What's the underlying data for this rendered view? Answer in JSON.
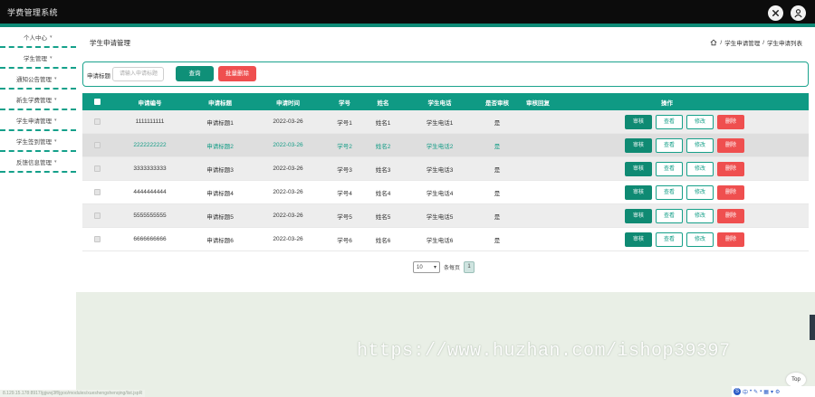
{
  "app": {
    "title": "学费管理系统"
  },
  "sidebar": {
    "items": [
      {
        "label": "个人中心"
      },
      {
        "label": "学生管理"
      },
      {
        "label": "通知公告管理"
      },
      {
        "label": "新生学费管理"
      },
      {
        "label": "学生申请管理"
      },
      {
        "label": "学生签到管理"
      },
      {
        "label": "反馈信息管理"
      }
    ]
  },
  "page": {
    "title": "学生申请管理",
    "breadcrumb": {
      "level1": "学生申请管理",
      "level2": "学生申请列表"
    }
  },
  "search": {
    "label": "申请标题",
    "placeholder": "请输入申请标题",
    "query_button": "查询",
    "batch_delete_button": "批量删除"
  },
  "table": {
    "headers": [
      "申请编号",
      "申请标题",
      "申请时间",
      "学号",
      "姓名",
      "学生电话",
      "是否审核",
      "审核回复",
      "操作"
    ],
    "rows": [
      {
        "id": "1111111111",
        "title": "申请标题1",
        "date": "2022-03-26",
        "student_no": "学号1",
        "name": "姓名1",
        "phone": "学生电话1",
        "audited": "是",
        "reply": ""
      },
      {
        "id": "2222222222",
        "title": "申请标题2",
        "date": "2022-03-26",
        "student_no": "学号2",
        "name": "姓名2",
        "phone": "学生电话2",
        "audited": "是",
        "reply": ""
      },
      {
        "id": "3333333333",
        "title": "申请标题3",
        "date": "2022-03-26",
        "student_no": "学号3",
        "name": "姓名3",
        "phone": "学生电话3",
        "audited": "是",
        "reply": ""
      },
      {
        "id": "4444444444",
        "title": "申请标题4",
        "date": "2022-03-26",
        "student_no": "学号4",
        "name": "姓名4",
        "phone": "学生电话4",
        "audited": "是",
        "reply": ""
      },
      {
        "id": "5555555555",
        "title": "申请标题5",
        "date": "2022-03-26",
        "student_no": "学号5",
        "name": "姓名5",
        "phone": "学生电话5",
        "audited": "是",
        "reply": ""
      },
      {
        "id": "6666666666",
        "title": "申请标题6",
        "date": "2022-03-26",
        "student_no": "学号6",
        "name": "姓名6",
        "phone": "学生电话6",
        "audited": "是",
        "reply": ""
      }
    ],
    "actions": {
      "audit": "审核",
      "view": "查看",
      "edit": "修改",
      "delete": "删除"
    }
  },
  "pagination": {
    "page_size": "10",
    "suffix": "条每页",
    "current_page": "1"
  },
  "footer": {
    "watermark": "https://www.huzhan.com/ishop39397",
    "status_url": "8.129.15.178:8917/jgjwvj3ff/jgoo/modules/xueshengshenqing/list.jspR",
    "top_button": "Top"
  }
}
